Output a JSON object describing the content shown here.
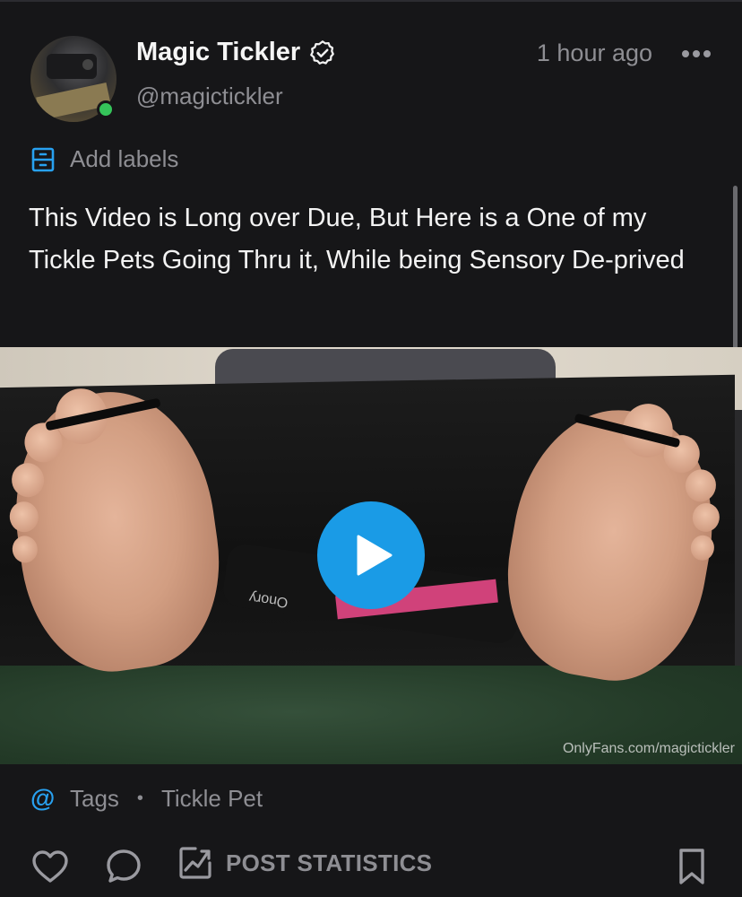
{
  "post": {
    "author": {
      "name": "Magic Tickler",
      "handle": "@magictickler",
      "verified": true,
      "online": true
    },
    "timestamp": "1 hour ago",
    "labels_action": "Add labels",
    "text": "This Video is Long over Due, But Here is a One of my Tickle Pets Going Thru it, While being Sensory De-prived",
    "media": {
      "type": "video",
      "watermark": "OnlyFans.com/magictickler",
      "strap_text": "Onory"
    },
    "tags": {
      "label": "Tags",
      "items": [
        "Tickle Pet"
      ]
    },
    "actions": {
      "stats_label": "POST STATISTICS"
    }
  },
  "colors": {
    "background": "#161618",
    "accent": "#1a9be6",
    "muted_text": "#8e8e93",
    "online": "#35c45a"
  },
  "icons": [
    "verified-icon",
    "more-icon",
    "labels-icon",
    "play-icon",
    "at-icon",
    "like-icon",
    "comment-icon",
    "stats-icon",
    "bookmark-icon"
  ]
}
